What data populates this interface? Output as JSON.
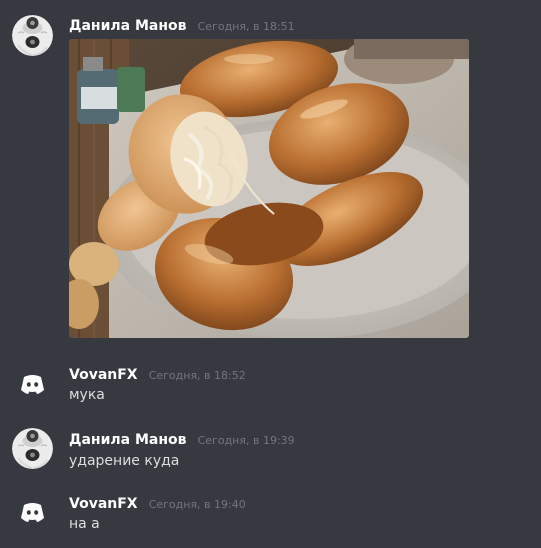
{
  "messages": [
    {
      "author": "Данила Манов",
      "timestamp": "Сегодня, в 18:51",
      "text": "",
      "avatar_icon": "cat-face-icon",
      "attachment": "pirozhki-photo"
    },
    {
      "author": "VovanFX",
      "timestamp": "Сегодня, в 18:52",
      "text": "мука",
      "avatar_icon": "discord-logo-icon"
    },
    {
      "author": "Данила Манов",
      "timestamp": "Сегодня, в 19:39",
      "text": "ударение куда",
      "avatar_icon": "cat-face-icon"
    },
    {
      "author": "VovanFX",
      "timestamp": "Сегодня, в 19:40",
      "text": "на а",
      "avatar_icon": "discord-logo-icon"
    }
  ],
  "colors": {
    "background": "#36393f",
    "username": "#ffffff",
    "timestamp": "#72767d",
    "message_text": "#dcddde"
  }
}
